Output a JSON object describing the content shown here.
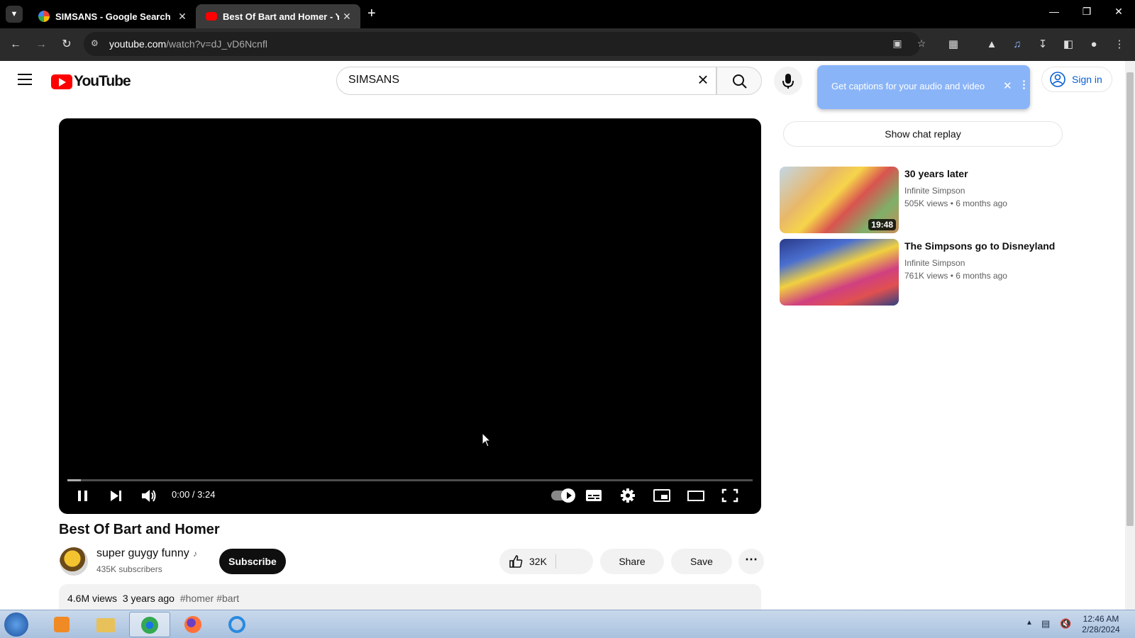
{
  "browser": {
    "tabs": [
      {
        "label": "SIMSANS - Google Search",
        "active": false
      },
      {
        "label": "Best Of Bart and Homer - YouT",
        "active": true
      }
    ],
    "url_host": "youtube.com",
    "url_path": "/watch?v=dJ_vD6Ncnfl"
  },
  "header": {
    "logo_text": "YouTube",
    "search_value": "SIMSANS",
    "caption_popup": "Get captions for your audio and video",
    "sign_in": "Sign in"
  },
  "player": {
    "time": "0:00 / 3:24",
    "progress_fraction": 0.02
  },
  "video": {
    "title": "Best Of Bart and Homer",
    "channel": "super guygy funny",
    "subscribers": "435K subscribers",
    "subscribe_label": "Subscribe",
    "likes": "32K",
    "share_label": "Share",
    "save_label": "Save",
    "views": "4.6M views",
    "age": "3 years ago",
    "tags": "#homer #bart"
  },
  "sidebar": {
    "chat_replay": "Show chat replay",
    "recommendations": [
      {
        "title": "30 years later",
        "channel": "Infinite Simpson",
        "views": "505K views",
        "age": "6 months ago",
        "duration": "19:48"
      },
      {
        "title": "The Simpsons go to Disneyland",
        "channel": "Infinite Simpson",
        "views": "761K views",
        "age": "6 months ago",
        "duration": ""
      }
    ]
  },
  "taskbar": {
    "time": "12:46 AM",
    "date": "2/28/2024"
  },
  "colors": {
    "youtube_red": "#ff0000",
    "link_blue": "#065fd4",
    "caption_popup": "#8ab4f8"
  }
}
